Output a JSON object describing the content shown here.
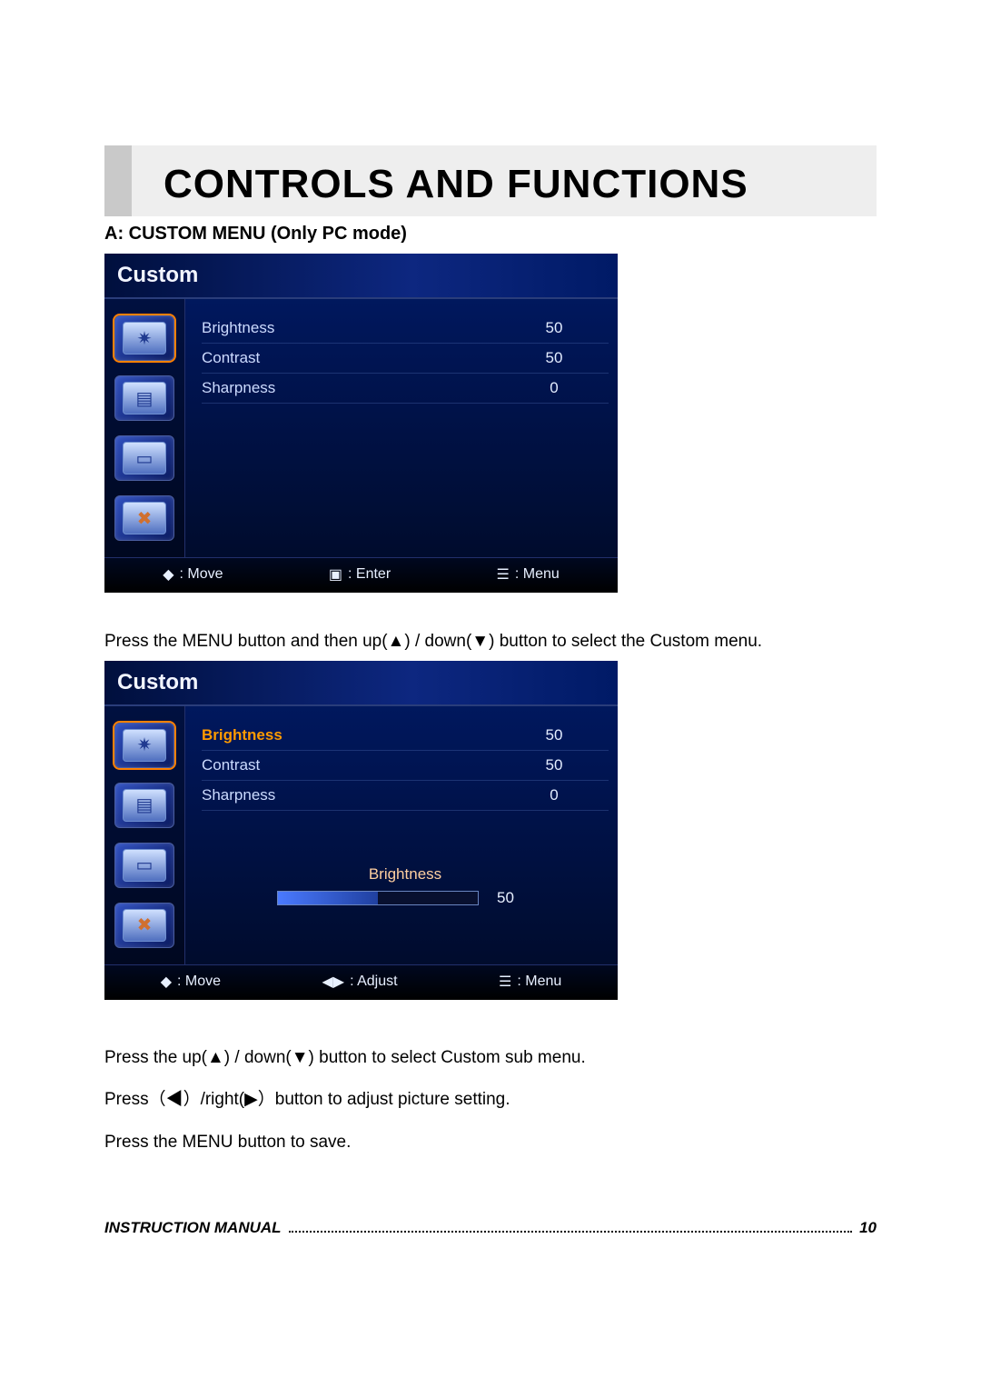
{
  "title": "CONTROLS AND FUNCTIONS",
  "subhead": "A: CUSTOM MENU (Only PC mode)",
  "osd1": {
    "header": "Custom",
    "rows": [
      {
        "label": "Brightness",
        "value": "50"
      },
      {
        "label": "Contrast",
        "value": "50"
      },
      {
        "label": "Sharpness",
        "value": "0"
      }
    ],
    "footer": {
      "move": ": Move",
      "enter": ": Enter",
      "menu": ": Menu"
    }
  },
  "para1": "Press the MENU button and then up(▲) / down(▼) button to select the Custom menu.",
  "osd2": {
    "header": "Custom",
    "rows": [
      {
        "label": "Brightness",
        "value": "50"
      },
      {
        "label": "Contrast",
        "value": "50"
      },
      {
        "label": "Sharpness",
        "value": "0"
      }
    ],
    "adjust": {
      "label": "Brightness",
      "value": "50"
    },
    "footer": {
      "move": ": Move",
      "adjust": ": Adjust",
      "menu": ": Menu"
    }
  },
  "para2": "Press the up(▲) / down(▼) button to select Custom sub menu.",
  "para3": "Press（◀）/right(▶）button to adjust picture setting.",
  "para4": "Press the MENU button to save.",
  "footer": {
    "label": "INSTRUCTION MANUAL",
    "page": "10"
  },
  "glyphs": {
    "updown": "◆",
    "square": "▣",
    "menu": "☰",
    "leftright": "◀▶"
  }
}
